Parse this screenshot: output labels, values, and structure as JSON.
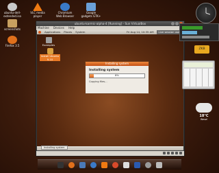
{
  "desktop_icons": [
    {
      "label": "ubuntu-dell-extended.iso",
      "color": "#c9c9c9"
    },
    {
      "label": "VLC media player",
      "color": "#f07a12"
    },
    {
      "label": "Chromium Web Browser",
      "color": "#3a7ac8"
    },
    {
      "label": "Google gadgets GTK+",
      "color": "#6aa0d8"
    },
    {
      "label": "screenshots",
      "color": "#c8a060"
    },
    {
      "label": "Firefox 3.5",
      "color": "#e0701c"
    }
  ],
  "vm": {
    "title": "ubuntu-karmic-alpha-4 [Running] - Sun VirtualBox",
    "menu": [
      "Machine",
      "Devices",
      "Help"
    ],
    "panel": {
      "left": [
        "Applications",
        "Places",
        "System"
      ],
      "clock": "Fri Aug 14, 10:35 AM",
      "live": "Live session user"
    },
    "guest_icons": [
      {
        "label": "Examples"
      },
      {
        "label": "Install Ubuntu 9.10"
      }
    ],
    "dialog": {
      "title": "Installing system",
      "heading": "Installing system",
      "progress_label": "8%",
      "progress": 0.08,
      "status": "Copying files..."
    },
    "taskbar_item": "Installing system"
  },
  "widgets": {
    "meter_label": "ZKB",
    "weather": {
      "temp": "18°C",
      "place": "Wesel"
    }
  },
  "colors": {
    "accent": "#e06a1e"
  }
}
